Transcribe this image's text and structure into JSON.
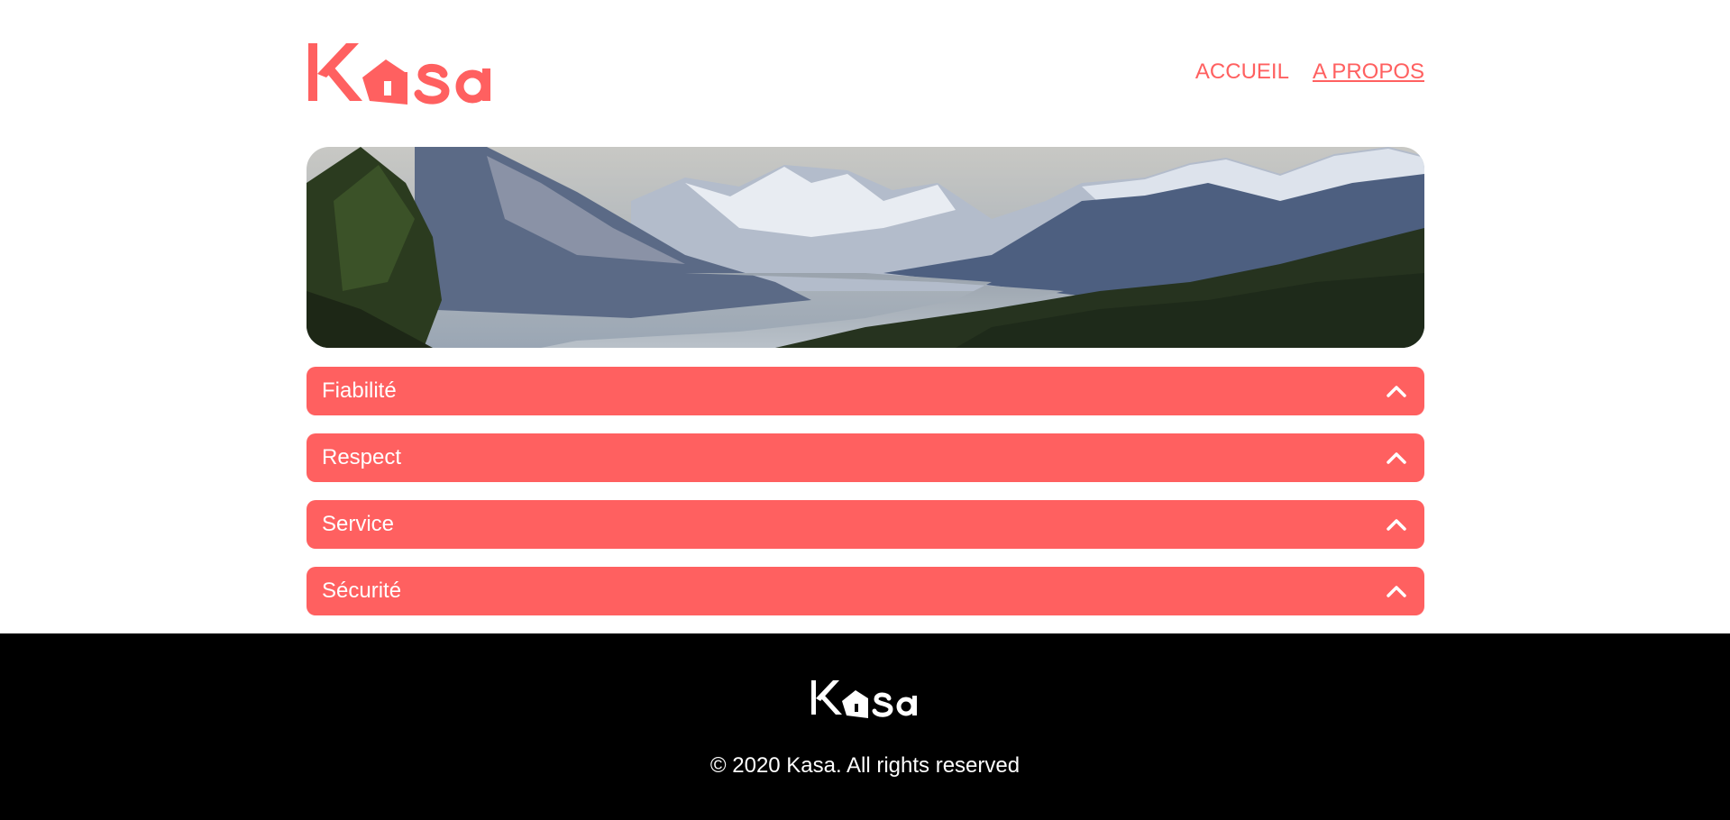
{
  "header": {
    "logo": "Kasa",
    "nav": [
      {
        "label": "ACCUEIL",
        "active": false
      },
      {
        "label": "A PROPOS",
        "active": true
      }
    ]
  },
  "banner": {
    "image": "mountain-valley-landscape"
  },
  "sections": [
    {
      "title": "Fiabilité",
      "icon": "chevron-up-icon"
    },
    {
      "title": "Respect",
      "icon": "chevron-up-icon"
    },
    {
      "title": "Service",
      "icon": "chevron-up-icon"
    },
    {
      "title": "Sécurité",
      "icon": "chevron-up-icon"
    }
  ],
  "footer": {
    "logo": "Kasa",
    "copyright": "© 2020 Kasa. All rights reserved"
  },
  "colors": {
    "brand": "#FF6060",
    "footer_bg": "#000000",
    "text_light": "#FFFFFF"
  }
}
